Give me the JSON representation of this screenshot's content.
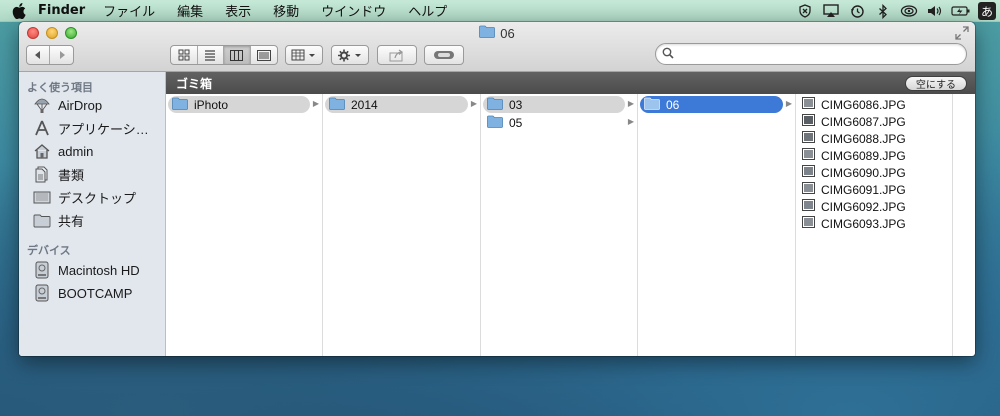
{
  "menubar": {
    "app_name": "Finder",
    "items": [
      "ファイル",
      "編集",
      "表示",
      "移動",
      "ウインドウ",
      "ヘルプ"
    ],
    "ime_label": "あ"
  },
  "window": {
    "title": "06",
    "search": {
      "value": "",
      "placeholder": ""
    }
  },
  "pathbar": {
    "label": "ゴミ箱",
    "empty_button": "空にする"
  },
  "sidebar": {
    "favorites_heading": "よく使う項目",
    "favorites": [
      {
        "label": "AirDrop",
        "icon": "airdrop-icon"
      },
      {
        "label": "アプリケーシ…",
        "icon": "applications-icon"
      },
      {
        "label": "admin",
        "icon": "home-icon"
      },
      {
        "label": "書類",
        "icon": "documents-icon"
      },
      {
        "label": "デスクトップ",
        "icon": "desktop-icon"
      },
      {
        "label": "共有",
        "icon": "folder-icon"
      }
    ],
    "devices_heading": "デバイス",
    "devices": [
      {
        "label": "Macintosh HD",
        "icon": "hard-drive-icon"
      },
      {
        "label": "BOOTCAMP",
        "icon": "hard-drive-icon"
      }
    ]
  },
  "columns": {
    "col1": [
      {
        "label": "iPhoto",
        "state": "path"
      }
    ],
    "col2": [
      {
        "label": "2014",
        "state": "path"
      }
    ],
    "col3": [
      {
        "label": "03",
        "state": "path"
      },
      {
        "label": "05",
        "state": "normal"
      }
    ],
    "col4": [
      {
        "label": "06",
        "state": "selected"
      }
    ],
    "files": [
      "CIMG6086.JPG",
      "CIMG6087.JPG",
      "CIMG6088.JPG",
      "CIMG6089.JPG",
      "CIMG6090.JPG",
      "CIMG6091.JPG",
      "CIMG6092.JPG",
      "CIMG6093.JPG"
    ]
  },
  "colors": {
    "selection": "#3d79d6",
    "folder": "#7fb2e0",
    "pathbar": "#555555"
  }
}
